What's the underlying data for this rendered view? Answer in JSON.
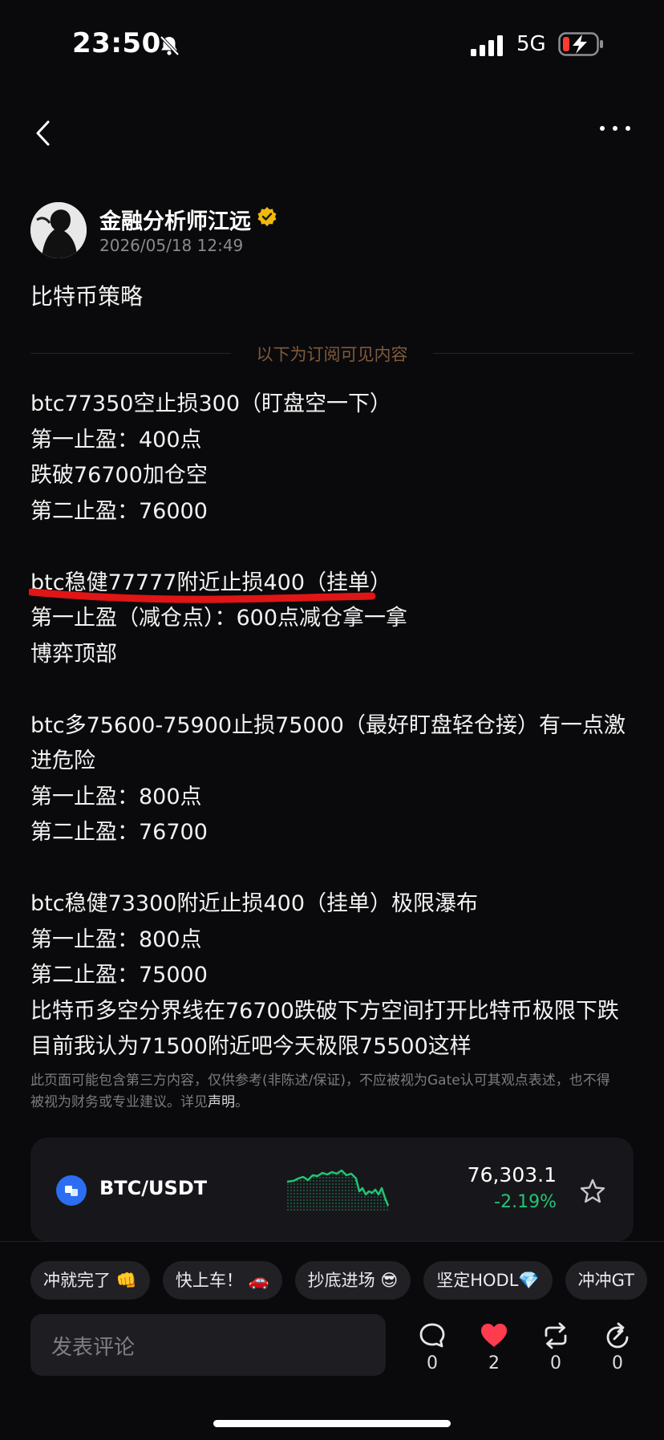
{
  "status_bar": {
    "time": "23:50",
    "network": "5G"
  },
  "post": {
    "author": "金融分析师江远",
    "timestamp": "2026/05/18 12:49",
    "title": "比特币策略",
    "subscriber_divider": "以下为订阅可见内容",
    "lines": [
      "btc77350空止损300（盯盘空一下）",
      "第一止盈：400点",
      "跌破76700加仓空",
      "第二止盈：76000",
      "",
      "btc稳健77777附近止损400（挂单）",
      "第一止盈（减仓点）：600点减仓拿一拿",
      "博弈顶部",
      "",
      "btc多75600-75900止损75000（最好盯盘轻仓接）有一点激进危险",
      "第一止盈：800点",
      "第二止盈：76700",
      "",
      "btc稳健73300附近止损400（挂单）极限瀑布",
      "第一止盈：800点",
      "第二止盈：75000",
      "比特币多空分界线在76700跌破下方空间打开比特币极限下跌目前我认为71500附近吧今天极限75500这样"
    ],
    "disclaimer_text": "此页面可能包含第三方内容，仅供参考(非陈述/保证)，不应被视为Gate认可其观点表述，也不得被视为财务或专业建议。详见",
    "disclaimer_link": "声明",
    "disclaimer_end": "。"
  },
  "ticker": {
    "pair": "BTC/USDT",
    "price": "76,303.1",
    "change": "-2.19%",
    "change_color": "#23c475",
    "icon": "coin-icon"
  },
  "reactions": [
    {
      "label": "冲就完了 👊"
    },
    {
      "label": "快上车！ 🚗"
    },
    {
      "label": "抄底进场 😎"
    },
    {
      "label": "坚定HODL💎"
    },
    {
      "label": "冲冲GT"
    }
  ],
  "comment": {
    "placeholder": "发表评论"
  },
  "actions": {
    "comment_count": "0",
    "like_count": "2",
    "repost_count": "0",
    "share_count": "0"
  }
}
